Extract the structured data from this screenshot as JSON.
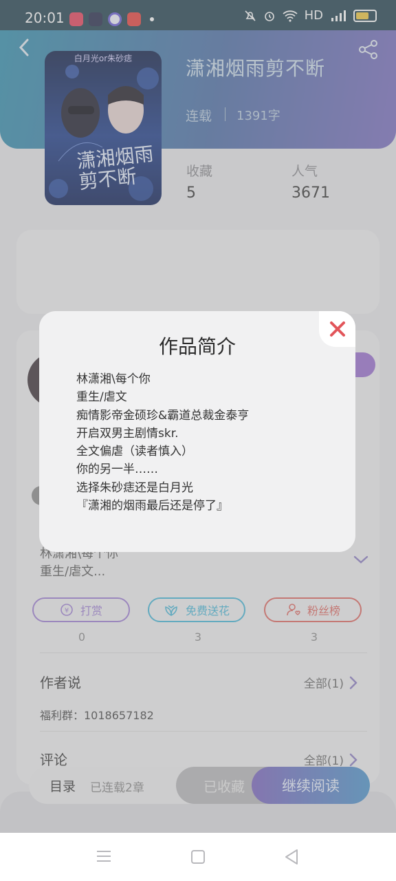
{
  "status_bar": {
    "time": "20:01",
    "right_text": "HD",
    "app_icons": [
      "video-app-icon",
      "dark-app-icon",
      "browser-app-icon",
      "music-app-icon"
    ]
  },
  "book": {
    "title": "潇湘烟雨剪不断",
    "status": "连载",
    "word_count": "1391字",
    "cover_top_text": "白月光or朱砂痣",
    "cover_title": "潇湘烟雨剪不断",
    "stats": [
      {
        "label": "收藏",
        "value": "5"
      },
      {
        "label": "人气",
        "value": "3671"
      }
    ]
  },
  "description": {
    "snippet_lines": [
      "林潇湘\\每个你",
      "重生/虐文..."
    ]
  },
  "actions": [
    {
      "label": "打赏",
      "count": "0",
      "color": "#9f7fd6",
      "icon": "coin-icon"
    },
    {
      "label": "免费送花",
      "count": "3",
      "color": "#45b7d8",
      "icon": "flower-icon"
    },
    {
      "label": "粉丝榜",
      "count": "3",
      "color": "#e0665f",
      "icon": "fans-icon"
    }
  ],
  "author_says": {
    "title": "作者说",
    "all_label": "全部(1)",
    "content": "福利群：1018657182"
  },
  "comments": {
    "title": "评论",
    "all_label": "全部(1)"
  },
  "bottom_bar": {
    "toc_label": "目录",
    "chapters_label": "已连载2章",
    "collected_label": "已收藏",
    "continue_label": "继续阅读"
  },
  "modal": {
    "title": "作品简介",
    "lines": [
      "林潇湘\\每个你",
      "重生/虐文",
      "痴情影帝金硕珍&霸道总裁金泰亨",
      "开启双男主剧情skr.",
      "全文偏虐（读者慎入）",
      "你的另一半……",
      "选择朱砂痣还是白月光",
      "『潇湘的烟雨最后还是停了』"
    ]
  },
  "colors": {
    "header_gradient_start": "#2f8fae",
    "header_gradient_end": "#7a6cc0",
    "close_x": "#e2555a",
    "continue_gradient_start": "#7a63bf",
    "continue_gradient_end": "#4a94cc"
  }
}
